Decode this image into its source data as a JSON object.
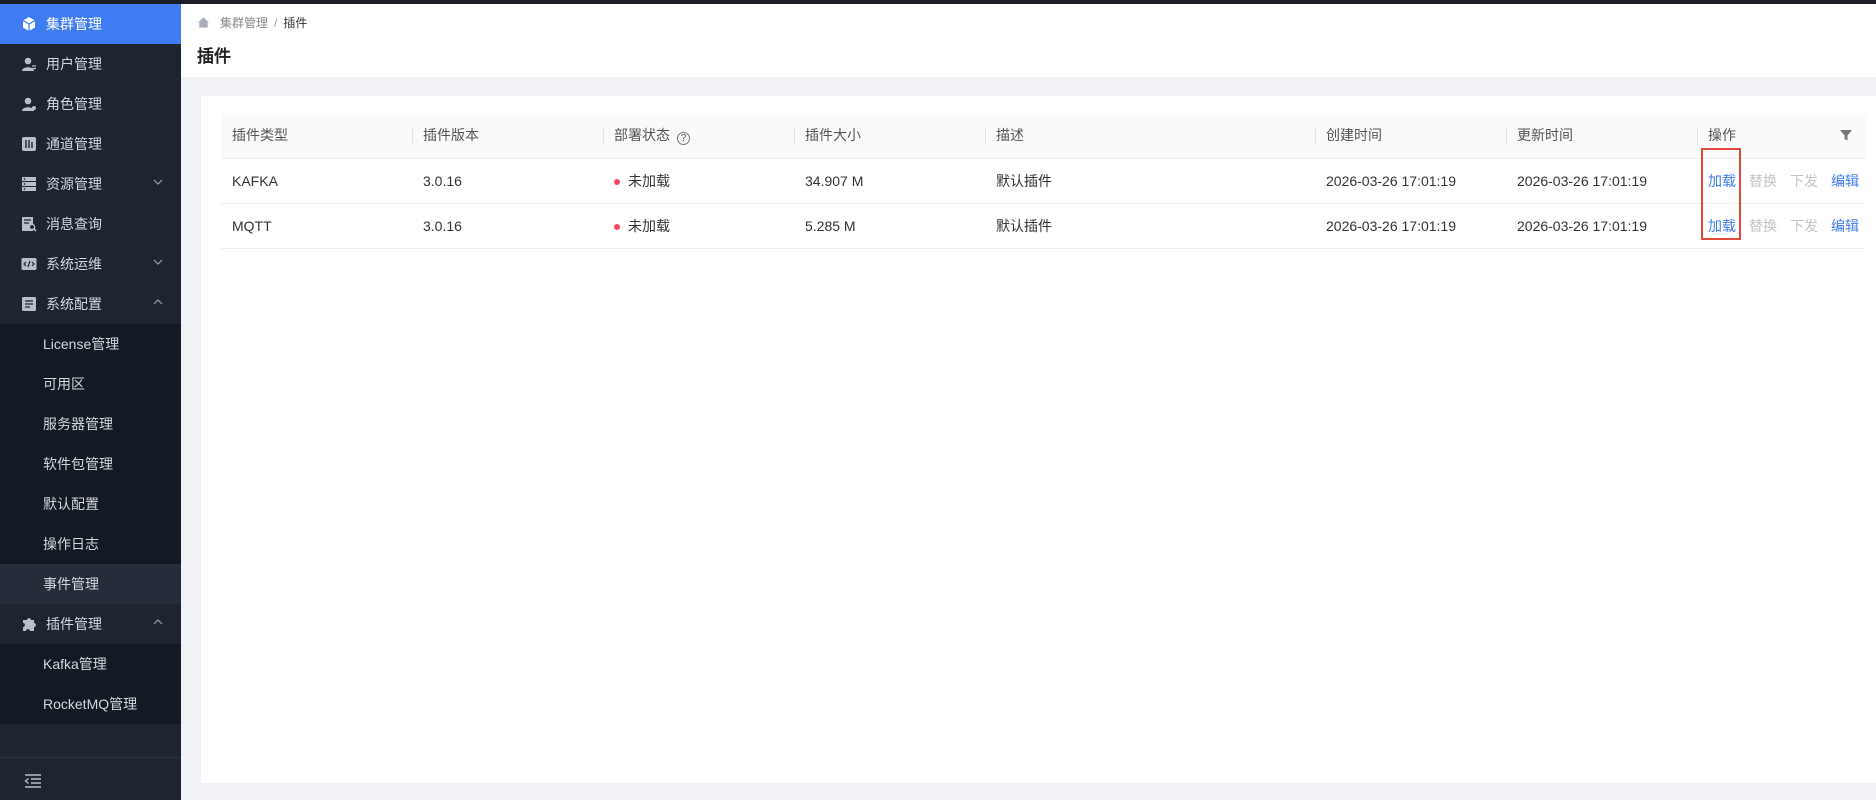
{
  "sidebar": {
    "items": [
      {
        "label": "集群管理",
        "icon": "cube-icon"
      },
      {
        "label": "用户管理",
        "icon": "user-icon"
      },
      {
        "label": "角色管理",
        "icon": "role-icon"
      },
      {
        "label": "通道管理",
        "icon": "channel-icon"
      },
      {
        "label": "资源管理",
        "icon": "server-icon"
      },
      {
        "label": "消息查询",
        "icon": "message-search-icon"
      },
      {
        "label": "系统运维",
        "icon": "code-icon"
      },
      {
        "label": "系统配置",
        "icon": "config-icon"
      },
      {
        "label": "插件管理",
        "icon": "puzzle-icon"
      }
    ],
    "config_children": [
      "License管理",
      "可用区",
      "服务器管理",
      "软件包管理",
      "默认配置",
      "操作日志",
      "事件管理"
    ],
    "plugin_children": [
      "Kafka管理",
      "RocketMQ管理"
    ]
  },
  "breadcrumb": {
    "root": "集群管理",
    "separator": "/",
    "current": "插件"
  },
  "page_title": "插件",
  "table": {
    "columns": [
      "插件类型",
      "插件版本",
      "部署状态",
      "插件大小",
      "描述",
      "创建时间",
      "更新时间",
      "操作"
    ],
    "help_glyph": "?",
    "rows": [
      {
        "type": "KAFKA",
        "version": "3.0.16",
        "status": "未加载",
        "size": "34.907 M",
        "desc": "默认插件",
        "created": "2026-03-26 17:01:19",
        "updated": "2026-03-26 17:01:19"
      },
      {
        "type": "MQTT",
        "version": "3.0.16",
        "status": "未加载",
        "size": "5.285 M",
        "desc": "默认插件",
        "created": "2026-03-26 17:01:19",
        "updated": "2026-03-26 17:01:19"
      }
    ],
    "actions": {
      "load": "加载",
      "replace": "替换",
      "dispatch": "下发",
      "edit": "编辑"
    }
  },
  "colors": {
    "primary": "#3f7cf1",
    "sidebar_bg": "#1e2430",
    "status_error": "#f5475a",
    "highlight": "#e5483a"
  }
}
